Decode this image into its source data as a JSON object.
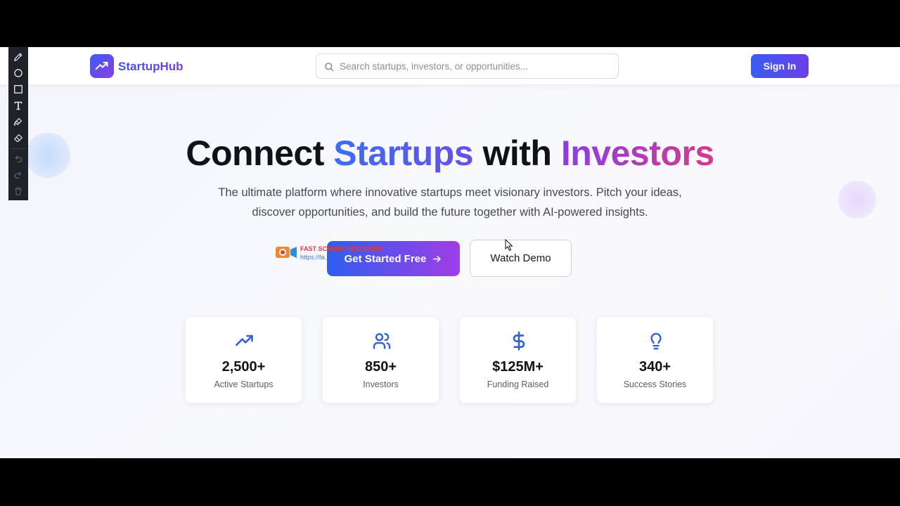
{
  "header": {
    "brand": "StartupHub",
    "search_placeholder": "Search startups, investors, or opportunities...",
    "signin_label": "Sign In"
  },
  "hero": {
    "headline_part1": "Connect ",
    "headline_highlight1": "Startups",
    "headline_part2": " with ",
    "headline_highlight2": "Investors",
    "subtitle": "The ultimate platform where innovative startups meet visionary investors. Pitch your ideas, discover opportunities, and build the future together with AI-powered insights.",
    "primary_cta": "Get Started Free",
    "secondary_cta": "Watch Demo"
  },
  "stats": [
    {
      "value": "2,500+",
      "label": "Active Startups",
      "icon": "trending-up-icon"
    },
    {
      "value": "850+",
      "label": "Investors",
      "icon": "users-icon"
    },
    {
      "value": "$125M+",
      "label": "Funding Raised",
      "icon": "dollar-icon"
    },
    {
      "value": "340+",
      "label": "Success Stories",
      "icon": "lightbulb-icon"
    }
  ],
  "watermark": {
    "title": "FAST SCREEN RECORDER",
    "url": "https://fa..."
  },
  "annotation_toolbar": {
    "tools": [
      "pencil-icon",
      "circle-icon",
      "rectangle-icon",
      "text-icon",
      "highlighter-icon",
      "eraser-icon",
      "undo-icon",
      "redo-icon",
      "trash-icon"
    ]
  },
  "colors": {
    "brand_gradient_start": "#3a5cf2",
    "brand_gradient_end": "#8b3ee8",
    "accent_pink": "#d63a8e",
    "icon_blue": "#2f5fd0"
  }
}
